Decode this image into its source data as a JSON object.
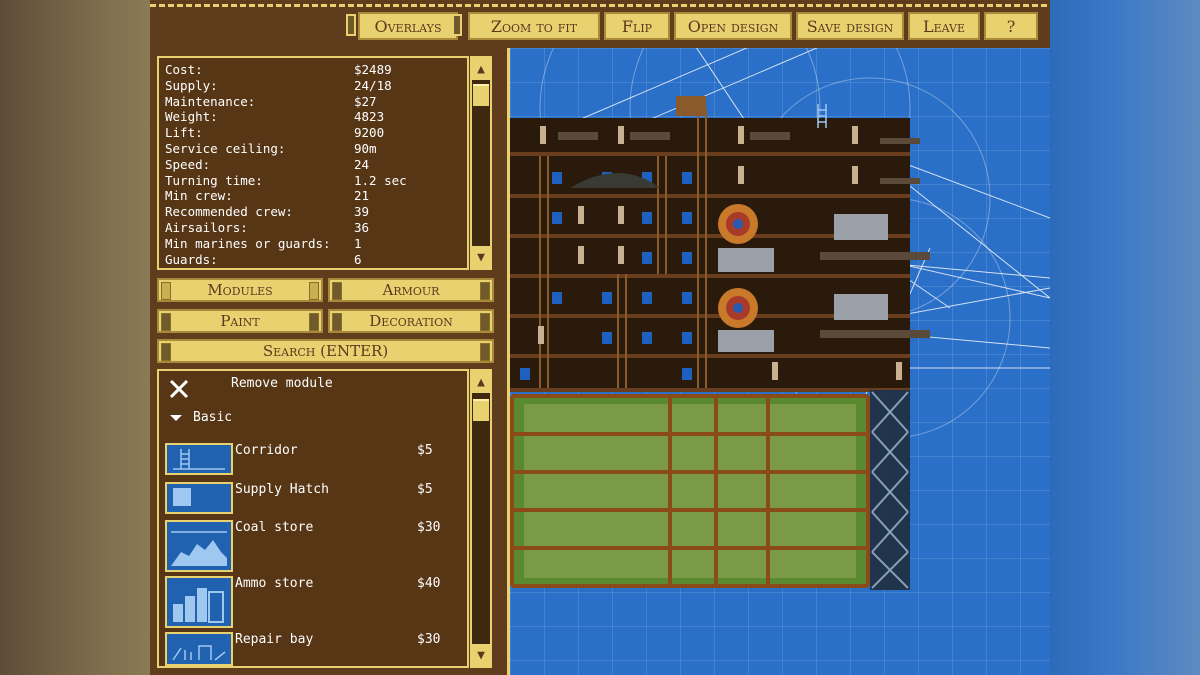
{
  "toolbar": {
    "overlays": "Overlays",
    "zoom_to_fit": "Zoom to fit",
    "flip": "Flip",
    "open_design": "Open design",
    "save_design": "Save design",
    "leave": "Leave",
    "help": "?"
  },
  "stats": [
    {
      "label": "Cost:",
      "value": "$2489"
    },
    {
      "label": "Supply:",
      "value": "24/18"
    },
    {
      "label": "Maintenance:",
      "value": "$27"
    },
    {
      "label": "Weight:",
      "value": "4823"
    },
    {
      "label": "Lift:",
      "value": "9200"
    },
    {
      "label": "Service ceiling:",
      "value": "90m"
    },
    {
      "label": "Speed:",
      "value": "24"
    },
    {
      "label": "Turning time:",
      "value": "1.2 sec"
    },
    {
      "label": "Min crew:",
      "value": "21"
    },
    {
      "label": "Recommended crew:",
      "value": "39"
    },
    {
      "label": "Airsailors:",
      "value": "36"
    },
    {
      "label": "Min marines or guards:",
      "value": "1"
    },
    {
      "label": "Guards:",
      "value": "6"
    }
  ],
  "tabs": {
    "modules": "Modules",
    "armour": "Armour",
    "paint": "Paint",
    "decoration": "Decoration",
    "search": "Search (ENTER)"
  },
  "module_list": {
    "remove_label": "Remove module",
    "category": "Basic",
    "items": [
      {
        "name": "Corridor",
        "price": "$5"
      },
      {
        "name": "Supply Hatch",
        "price": "$5"
      },
      {
        "name": "Coal store",
        "price": "$30"
      },
      {
        "name": "Ammo store",
        "price": "$40"
      },
      {
        "name": "Repair bay",
        "price": "$30"
      }
    ]
  },
  "scroll": {
    "up": "▲",
    "down": "▼"
  },
  "colors": {
    "panel_brown": "#5e3c1c",
    "gold": "#e8d270",
    "blueprint_blue": "#2a6fc8",
    "balloon_green": "#7a9a48"
  }
}
